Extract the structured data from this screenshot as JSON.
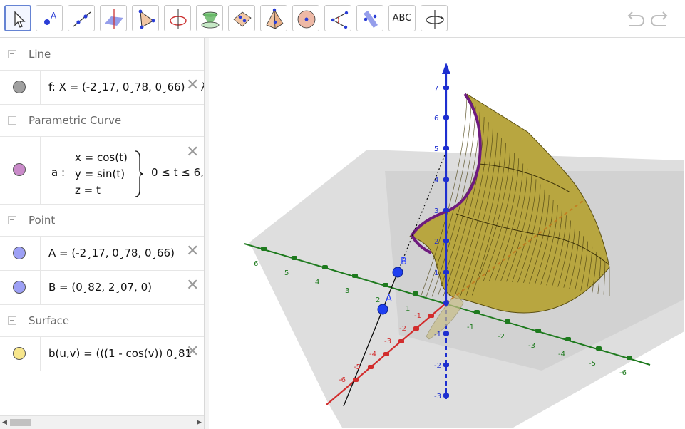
{
  "toolbar": {
    "tools": [
      {
        "name": "move-tool",
        "icon": "arrow-cursor-icon"
      },
      {
        "name": "point-tool",
        "icon": "point-icon"
      },
      {
        "name": "line-tool",
        "icon": "line-icon"
      },
      {
        "name": "perpendicular-plane-tool",
        "icon": "plane-icon"
      },
      {
        "name": "polygon-tool",
        "icon": "triangle-icon"
      },
      {
        "name": "circle-axis-point-tool",
        "icon": "circle-axis-icon"
      },
      {
        "name": "cone-tool",
        "icon": "cone-icon"
      },
      {
        "name": "intersect-surfaces-tool",
        "icon": "intersect-icon"
      },
      {
        "name": "pyramid-tool",
        "icon": "pyramid-icon"
      },
      {
        "name": "sphere-tool",
        "icon": "sphere-icon"
      },
      {
        "name": "angle-tool",
        "icon": "angle-icon"
      },
      {
        "name": "reflect-plane-tool",
        "icon": "reflect-icon"
      },
      {
        "name": "text-tool",
        "icon": "abc-text-icon"
      },
      {
        "name": "rotate-view-tool",
        "icon": "rotate-view-icon"
      }
    ],
    "text_tool_label": "ABC"
  },
  "algebra": {
    "groups": {
      "line": "Line",
      "curve": "Parametric Curve",
      "point": "Point",
      "surface": "Surface"
    },
    "items": {
      "f": {
        "text": "f: X = (-2¸17, 0¸78, 0¸66) + λ",
        "color": "#a0a0a0"
      },
      "a": {
        "prefix": "a :",
        "x": "x = cos(t)",
        "y": "y = sin(t)",
        "z": "z = t",
        "range": "0 ≤ t ≤ 6,",
        "color": "#c98ac9"
      },
      "A": {
        "text": "A = (-2¸17, 0¸78, 0¸66)",
        "color": "#9da0f5"
      },
      "B": {
        "text": "B = (0¸82, 2¸07, 0)",
        "color": "#9da0f5"
      },
      "b": {
        "text": "b(u,v) = (((1 - cos(v)) 0¸81",
        "color": "#f7e68c"
      }
    }
  },
  "graphics": {
    "z_ticks": [
      "7",
      "6",
      "5",
      "4",
      "3",
      "2",
      "1",
      "-1",
      "-2",
      "-3"
    ],
    "y_ticks": [
      "6",
      "5",
      "4",
      "3",
      "2",
      "1",
      "-1",
      "-2",
      "-3",
      "-4",
      "-5",
      "-6"
    ],
    "x_ticks": [
      "-1",
      "-2",
      "-3",
      "-4",
      "-5",
      "-6"
    ],
    "point_A": "A",
    "point_B": "B",
    "colors": {
      "x_axis": "#d22d2d",
      "y_axis": "#1e7a1e",
      "z_axis": "#1e2fd0",
      "surface": "#b8a640",
      "curve": "#6e1b7e",
      "point": "#1f3ff0"
    }
  }
}
